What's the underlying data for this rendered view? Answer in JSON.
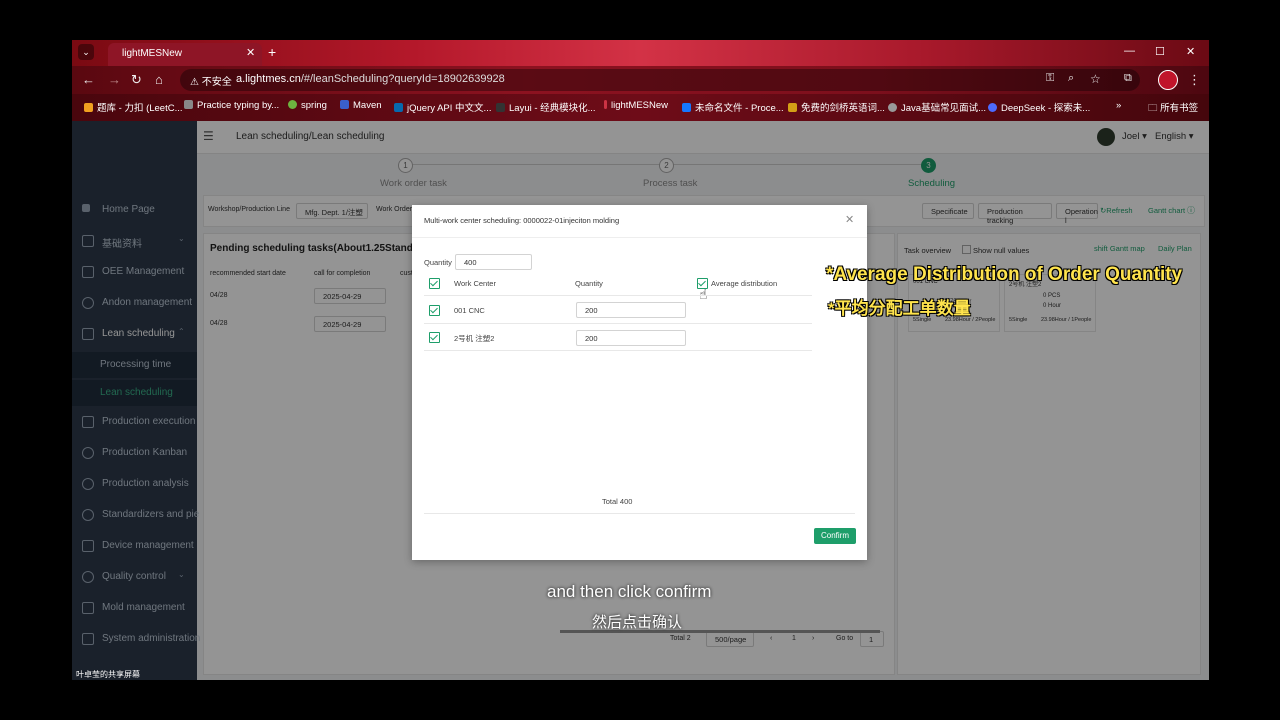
{
  "browser": {
    "tab_title": "lightMESNew",
    "security_label": "不安全",
    "url_host": "a.lightmes.cn",
    "url_path": "/#/leanScheduling?queryId=18902639928",
    "bookmarks": [
      {
        "label": "题库 - 力扣 (LeetC...",
        "color": "#f0a020"
      },
      {
        "label": "Practice typing by...",
        "color": "#888888"
      },
      {
        "label": "spring",
        "color": "#6db33f"
      },
      {
        "label": "Maven",
        "color": "#3a5fcd"
      },
      {
        "label": "jQuery API 中文文...",
        "color": "#0769ad"
      },
      {
        "label": "Layui - 经典模块化...",
        "color": "#333333"
      },
      {
        "label": "lightMESNew",
        "color": "#cc3344"
      },
      {
        "label": "未命名文件 - Proce...",
        "color": "#1677ff"
      },
      {
        "label": "免费的剑桥英语词...",
        "color": "#d4a017"
      },
      {
        "label": "Java基础常见面试...",
        "color": "#999999"
      },
      {
        "label": "DeepSeek - 探索未...",
        "color": "#4d6bfe"
      }
    ],
    "all_bookmarks": "所有书签",
    "more_bookmarks": "»"
  },
  "app": {
    "breadcrumb": "Lean scheduling/Lean scheduling",
    "user": "Joel",
    "language": "English",
    "sidebar": [
      {
        "label": "Home Page",
        "icon": "home-icon"
      },
      {
        "label": "基础资料",
        "icon": "document-icon"
      },
      {
        "label": "OEE Management",
        "icon": "chart-icon"
      },
      {
        "label": "Andon management",
        "icon": "bell-icon"
      },
      {
        "label": "Lean scheduling",
        "icon": "calendar-icon"
      },
      {
        "label": "Production execution",
        "icon": "play-icon"
      },
      {
        "label": "Production Kanban",
        "icon": "kanban-icon"
      },
      {
        "label": "Production analysis",
        "icon": "pie-icon"
      },
      {
        "label": "Standardizers and pie",
        "icon": "standard-icon"
      },
      {
        "label": "Device management",
        "icon": "device-icon"
      },
      {
        "label": "Quality control",
        "icon": "shield-icon"
      },
      {
        "label": "Mold management",
        "icon": "mold-icon"
      },
      {
        "label": "System administration",
        "icon": "system-icon"
      }
    ],
    "submenu": [
      {
        "label": "Processing time"
      },
      {
        "label": "Lean scheduling"
      }
    ],
    "steps": [
      {
        "num": "1",
        "label": "Work order task"
      },
      {
        "num": "2",
        "label": "Process task"
      },
      {
        "num": "3",
        "label": "Scheduling"
      }
    ],
    "filter_label": "Workshop/Production Line",
    "filter_value": "Mfg. Dept. 1/注塑",
    "work_order_label": "Work Order",
    "toolbar": [
      "Specificate",
      "Production tracking",
      "Operation l"
    ],
    "refresh": "Refresh",
    "gantt": "Gantt chart",
    "pending_title": "Pending scheduling tasks(About1.25Stand",
    "table_headers": [
      "recommended start date",
      "call for completion",
      "cust"
    ],
    "table_rows": [
      {
        "start": "04/28",
        "completion": "2025-04-29"
      },
      {
        "start": "04/28",
        "completion": "2025-04-29"
      }
    ],
    "task_overview": "Task overview",
    "show_null": "Show null values",
    "shift_gantt": "shift Gantt map",
    "daily_plan": "Daily Plan",
    "cards": [
      {
        "title": "001 CNC",
        "pcs": "",
        "hours": "0.75 Hour",
        "footer_left": "5Single",
        "footer_right": "23.98Hour / 2People"
      },
      {
        "title": "2号机 注塑2",
        "pcs": "0 PCS",
        "hours": "0 Hour",
        "footer_left": "5Single",
        "footer_right": "23.98Hour / 1People"
      }
    ],
    "pagination": {
      "total": "Total 2",
      "per_page": "500/page",
      "page": "1",
      "goto_label": "Go to",
      "goto_value": "1"
    }
  },
  "modal": {
    "title": "Multi-work center scheduling: 0000022-01injeciton molding",
    "quantity_label": "Quantity",
    "quantity_value": "400",
    "col_work_center": "Work Center",
    "col_quantity": "Quantity",
    "average_distribution": "Average distribution",
    "rows": [
      {
        "work_center": "001 CNC",
        "quantity": "200"
      },
      {
        "work_center": "2号机 注塑2",
        "quantity": "200"
      }
    ],
    "total": "Total 400",
    "confirm": "Confirm"
  },
  "annotation": {
    "line1": "*Average Distribution of Order Quantity",
    "line2": "*平均分配工单数量"
  },
  "subtitle": {
    "en": "and then click confirm",
    "zh": "然后点击确认"
  },
  "screen_share_label": "叶卓莹的共享屏幕"
}
